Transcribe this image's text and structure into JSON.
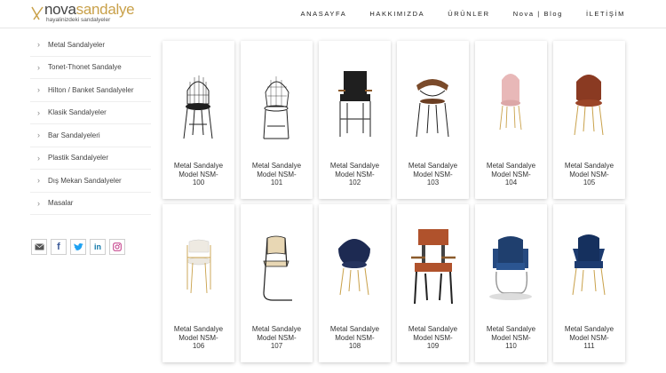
{
  "brand": {
    "name_part1": "nova",
    "name_part2": "sandalye",
    "tagline": "hayalinizdeki sandalyeler"
  },
  "nav": [
    "ANASAYFA",
    "HAKKIMIZDA",
    "ÜRÜNLER",
    "Nova | Blog",
    "İLETİŞİM"
  ],
  "sidebar": {
    "items": [
      "Metal Sandalyeler",
      "Tonet-Thonet Sandalye",
      "Hilton / Banket Sandalyeler",
      "Klasik Sandalyeler",
      "Bar Sandalyeleri",
      "Plastik Sandalyeler",
      "Dış Mekan Sandalyeler",
      "Masalar"
    ]
  },
  "social_icons": [
    "email-icon",
    "facebook-icon",
    "twitter-icon",
    "linkedin-icon",
    "instagram-icon"
  ],
  "colors": {
    "brand_gold": "#c9a14a",
    "text": "#333333"
  },
  "products": [
    {
      "l1": "Metal Sandalye",
      "l2": "Model NSM-",
      "l3": "100",
      "style": "wire-black"
    },
    {
      "l1": "Metal Sandalye",
      "l2": "Model NSM-",
      "l3": "101",
      "style": "wire-outline"
    },
    {
      "l1": "Metal Sandalye",
      "l2": "Model NSM-",
      "l3": "102",
      "style": "armchair-black"
    },
    {
      "l1": "Metal Sandalye",
      "l2": "Model NSM-",
      "l3": "103",
      "style": "wood-curve"
    },
    {
      "l1": "Metal Sandalye",
      "l2": "Model NSM-",
      "l3": "104",
      "style": "pink-shell"
    },
    {
      "l1": "Metal Sandalye",
      "l2": "Model NSM-",
      "l3": "105",
      "style": "rust-shell"
    },
    {
      "l1": "Metal Sandalye",
      "l2": "Model NSM-",
      "l3": "106",
      "style": "white-arm"
    },
    {
      "l1": "Metal Sandalye",
      "l2": "Model NSM-",
      "l3": "107",
      "style": "cane-cantilever"
    },
    {
      "l1": "Metal Sandalye",
      "l2": "Model NSM-",
      "l3": "108",
      "style": "navy-round"
    },
    {
      "l1": "Metal Sandalye",
      "l2": "Model NSM-",
      "l3": "109",
      "style": "leather-industrial"
    },
    {
      "l1": "Metal Sandalye",
      "l2": "Model NSM-",
      "l3": "110",
      "style": "blue-velvet-sled"
    },
    {
      "l1": "Metal Sandalye",
      "l2": "Model NSM-",
      "l3": "111",
      "style": "blue-velvet-gold"
    }
  ]
}
